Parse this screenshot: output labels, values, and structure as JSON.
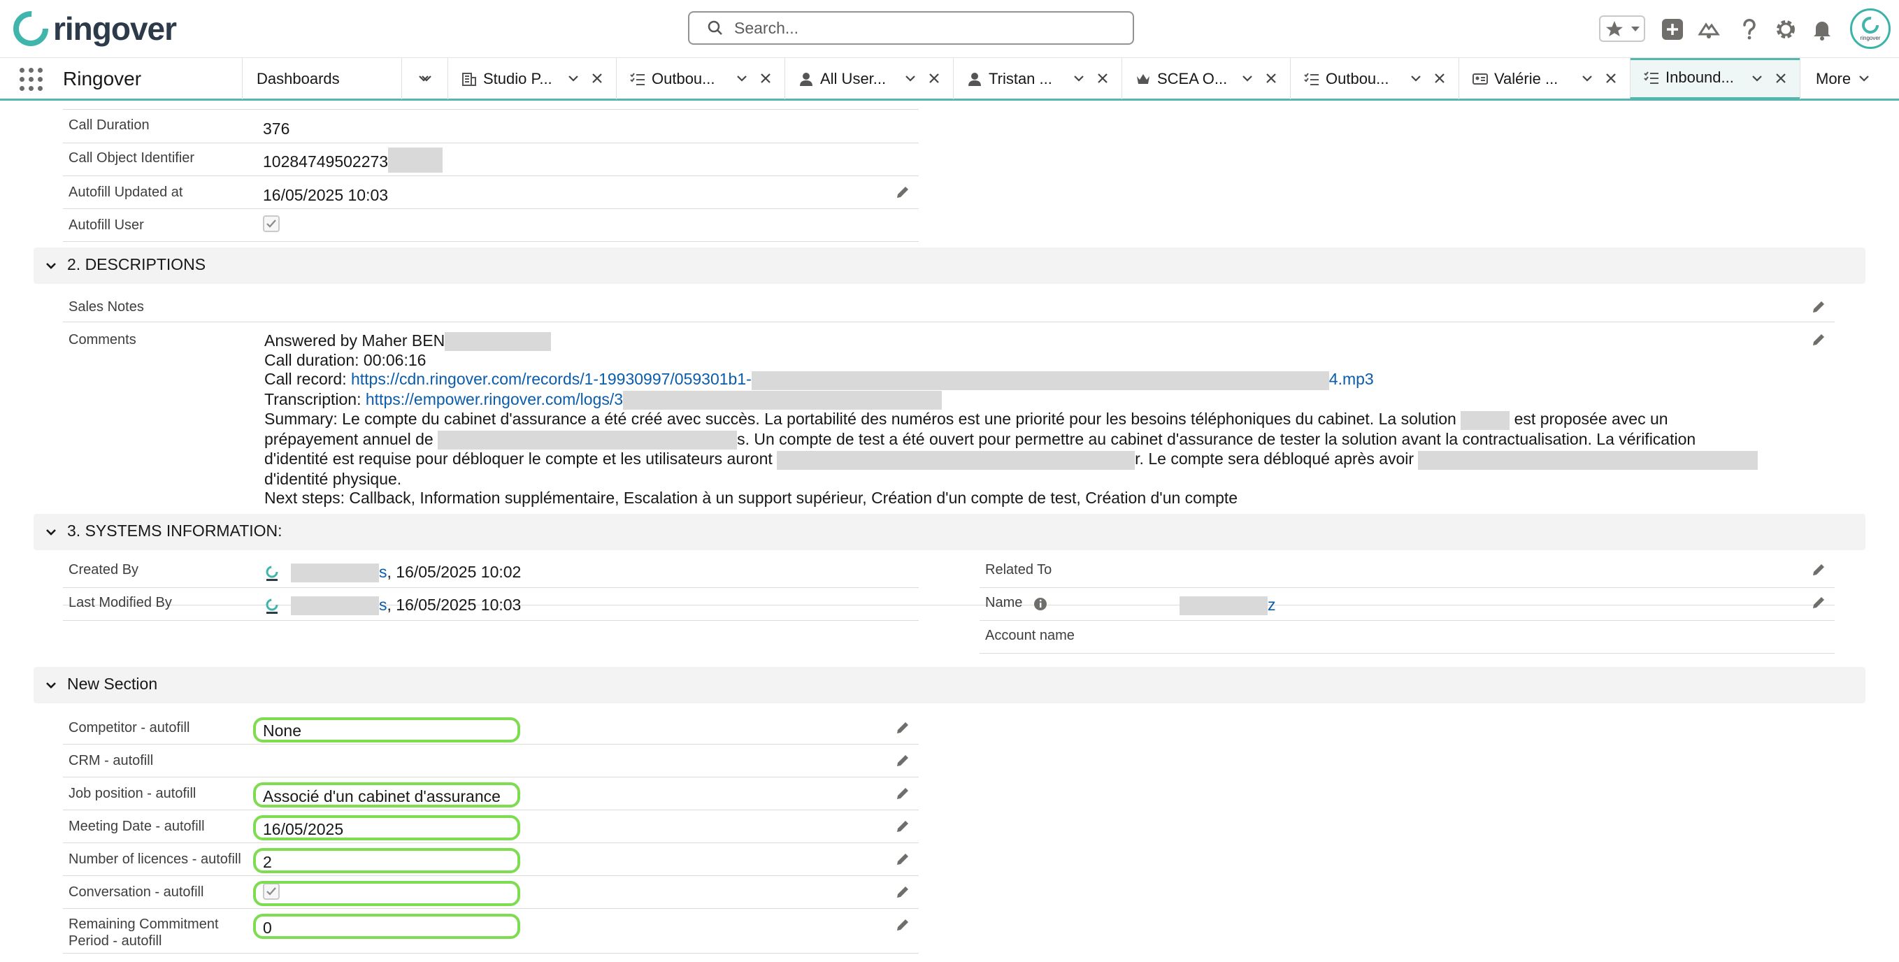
{
  "header": {
    "logo_text": "ringover",
    "search_placeholder": "Search...",
    "avatar_text": "ringover"
  },
  "nav": {
    "app_name": "Ringover",
    "tabs": [
      {
        "label": "Dashboards",
        "icon": "none"
      },
      {
        "label": "Studio P...",
        "icon": "building-icon"
      },
      {
        "label": "Outbou...",
        "icon": "list-check-icon"
      },
      {
        "label": "All User...",
        "icon": "user-icon"
      },
      {
        "label": "Tristan ...",
        "icon": "user-icon"
      },
      {
        "label": "SCEA O...",
        "icon": "crown-icon"
      },
      {
        "label": "Outbou...",
        "icon": "list-check-icon"
      },
      {
        "label": "Valérie ...",
        "icon": "id-card-icon"
      },
      {
        "label": "Inbound...",
        "icon": "list-check-icon"
      }
    ],
    "more_label": "More"
  },
  "top_fields": [
    {
      "label": "Call Duration",
      "value": "376"
    },
    {
      "label": "Call Object Identifier",
      "value": "10284749502273"
    },
    {
      "label": "Autofill Updated at",
      "value": "16/05/2025 10:03"
    },
    {
      "label": "Autofill User",
      "value": ""
    }
  ],
  "descriptions": {
    "title": "2. DESCRIPTIONS",
    "sales_notes_label": "Sales Notes",
    "comments_label": "Comments",
    "comments": {
      "answered_by": "Answered by Maher BEN",
      "call_duration": "Call duration: 00:06:16",
      "call_record_prefix": "Call record: ",
      "call_record_link_start": "https://cdn.ringover.com/records/1-19930997/059301b1-",
      "call_record_link_end": "4.mp3",
      "transcription_prefix": "Transcription: ",
      "transcription_link": "https://empower.ringover.com/logs/3",
      "summary_1": "Summary: Le compte du cabinet d'assurance a été créé avec succès. La portabilité des numéros est une priorité pour les besoins téléphoniques du cabinet. La solution ",
      "summary_2": " est proposée avec un",
      "summary_3": "prépayement annuel de ",
      "summary_4": "s. Un compte de test a été ouvert pour permettre au cabinet d'assurance de tester la solution avant la contractualisation. La vérification",
      "summary_5": "d'identité est requise pour débloquer le compte et les utilisateurs auront ",
      "summary_6": "r. Le compte sera débloqué après avoir ",
      "summary_7": "d'identité physique.",
      "next_steps": "Next steps: Callback, Information supplémentaire, Escalation à un support supérieur, Création d'un compte de test, Création d'un compte"
    }
  },
  "systems": {
    "title": "3. SYSTEMS INFORMATION:",
    "created_by_label": "Created By",
    "created_by_suffix": "s",
    "created_by_date": ", 16/05/2025 10:02",
    "last_modified_label": "Last Modified By",
    "last_modified_suffix": "s",
    "last_modified_date": ", 16/05/2025 10:03",
    "related_to_label": "Related To",
    "name_label": "Name",
    "name_suffix": "z",
    "account_name_label": "Account name"
  },
  "new_section": {
    "title": "New Section",
    "fields": [
      {
        "label": "Competitor - autofill",
        "value": "None"
      },
      {
        "label": "CRM - autofill",
        "value": ""
      },
      {
        "label": "Job position - autofill",
        "value": "Associé d'un cabinet d'assurance"
      },
      {
        "label": "Meeting Date - autofill",
        "value": "16/05/2025"
      },
      {
        "label": "Number of licences - autofill",
        "value": "2"
      },
      {
        "label": "Conversation - autofill",
        "value": ""
      },
      {
        "label": "Remaining Commitment Period - autofill",
        "value": "0"
      }
    ],
    "remaining_label_line1": "Remaining Commitment",
    "remaining_label_line2": "Period - autofill"
  },
  "colors": {
    "accent": "#55b6ae",
    "highlight": "#7ddc4f",
    "link": "#0b5cab",
    "section_bg": "#f3f3f3"
  }
}
